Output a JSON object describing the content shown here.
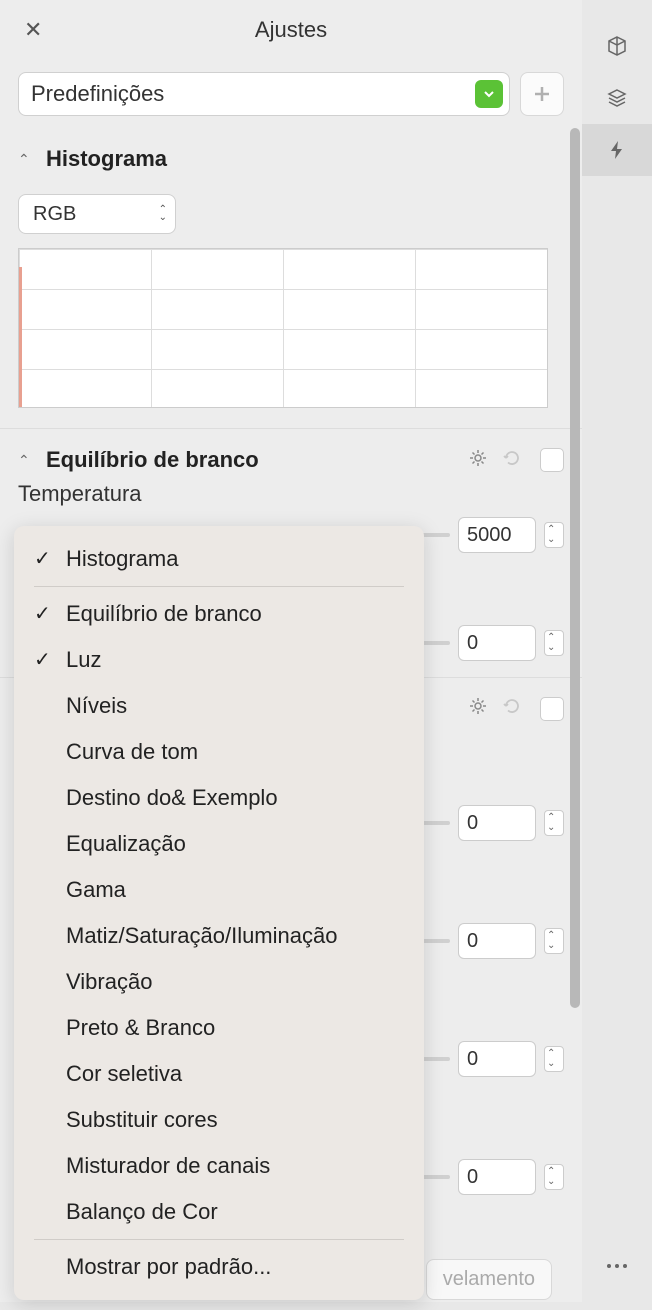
{
  "header": {
    "title": "Ajustes"
  },
  "presets": {
    "label": "Predefinições"
  },
  "sections": {
    "histogram": {
      "title": "Histograma",
      "channel": "RGB"
    },
    "whiteBalance": {
      "title": "Equilíbrio de branco",
      "temperature": {
        "label": "Temperatura",
        "value": "5000"
      },
      "tint": {
        "value": "0"
      }
    }
  },
  "valueRows": [
    {
      "value": "0"
    },
    {
      "value": "0"
    },
    {
      "value": "0"
    },
    {
      "value": "0"
    }
  ],
  "bottomButton": "velamento",
  "menu": {
    "items": [
      {
        "label": "Histograma",
        "checked": true
      },
      {
        "label": "Equilíbrio de branco",
        "checked": true
      },
      {
        "label": "Luz",
        "checked": true
      },
      {
        "label": "Níveis",
        "checked": false
      },
      {
        "label": "Curva de tom",
        "checked": false
      },
      {
        "label": "Destino do& Exemplo",
        "checked": false
      },
      {
        "label": "Equalização",
        "checked": false
      },
      {
        "label": "Gama",
        "checked": false
      },
      {
        "label": "Matiz/Saturação/Iluminação",
        "checked": false
      },
      {
        "label": "Vibração",
        "checked": false
      },
      {
        "label": "Preto & Branco",
        "checked": false
      },
      {
        "label": "Cor seletiva",
        "checked": false
      },
      {
        "label": "Substituir cores",
        "checked": false
      },
      {
        "label": "Misturador de canais",
        "checked": false
      },
      {
        "label": "Balanço de Cor",
        "checked": false
      }
    ],
    "footer": "Mostrar por padrão..."
  }
}
